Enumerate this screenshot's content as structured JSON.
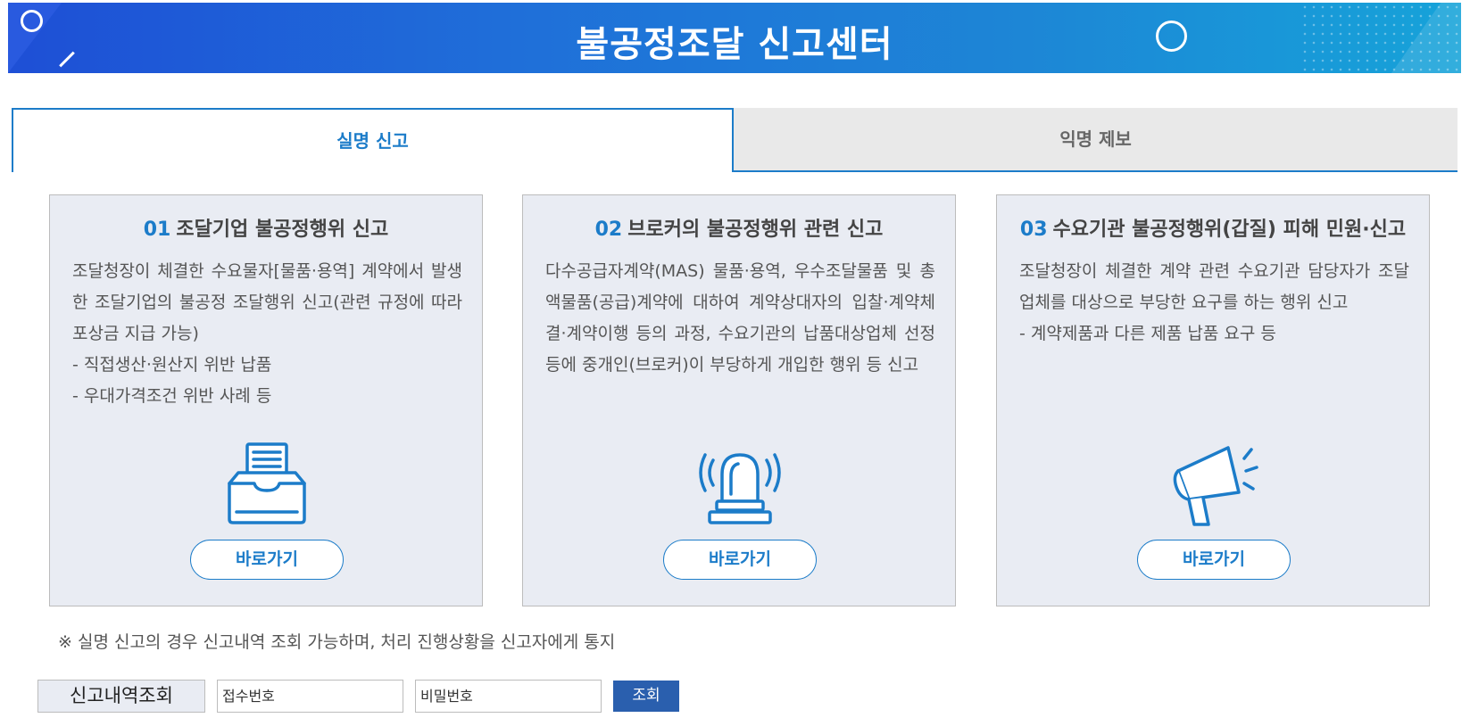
{
  "banner": {
    "title": "불공정조달 신고센터"
  },
  "tabs": [
    {
      "label": "실명 신고",
      "active": true
    },
    {
      "label": "익명 제보",
      "active": false
    }
  ],
  "cards": [
    {
      "num": "01",
      "title": "조달기업 불공정행위 신고",
      "desc": [
        "조달청장이 체결한 수요물자[물품·용역] 계약에서 발생한 조달기업의 불공정 조달행위 신고(관련 규정에 따라 포상금 지급 가능)",
        "- 직접생산·원산지 위반 납품",
        "- 우대가격조건 위반 사례 등"
      ],
      "icon": "document-tray-icon",
      "button": "바로가기"
    },
    {
      "num": "02",
      "title": "브로커의 불공정행위 관련 신고",
      "desc": [
        "다수공급자계약(MAS) 물품·용역, 우수조달물품 및 총액물품(공급)계약에 대하여 계약상대자의 입찰·계약체결·계약이행 등의 과정, 수요기관의 납품대상업체 선정 등에 중개인(브로커)이 부당하게 개입한 행위 등 신고"
      ],
      "icon": "siren-icon",
      "button": "바로가기"
    },
    {
      "num": "03",
      "title": "수요기관 불공정행위(갑질) 피해 민원·신고",
      "desc": [
        "조달청장이 체결한 계약 관련 수요기관 담당자가 조달업체를 대상으로 부당한 요구를 하는 행위 신고",
        "- 계약제품과 다른 제품 납품 요구 등"
      ],
      "icon": "megaphone-icon",
      "button": "바로가기"
    }
  ],
  "notice": "※ 실명 신고의 경우 신고내역 조회 가능하며, 처리 진행상황을 신고자에게 통지",
  "lookup": {
    "label": "신고내역조회",
    "receipt_placeholder": "접수번호",
    "password_placeholder": "비밀번호",
    "button": "조회"
  },
  "colors": {
    "accent": "#1c7cc9",
    "banner_start": "#1e4fd6",
    "banner_end": "#16a3d9",
    "card_bg": "#e9ecf3",
    "button_dark": "#2a5fae"
  }
}
